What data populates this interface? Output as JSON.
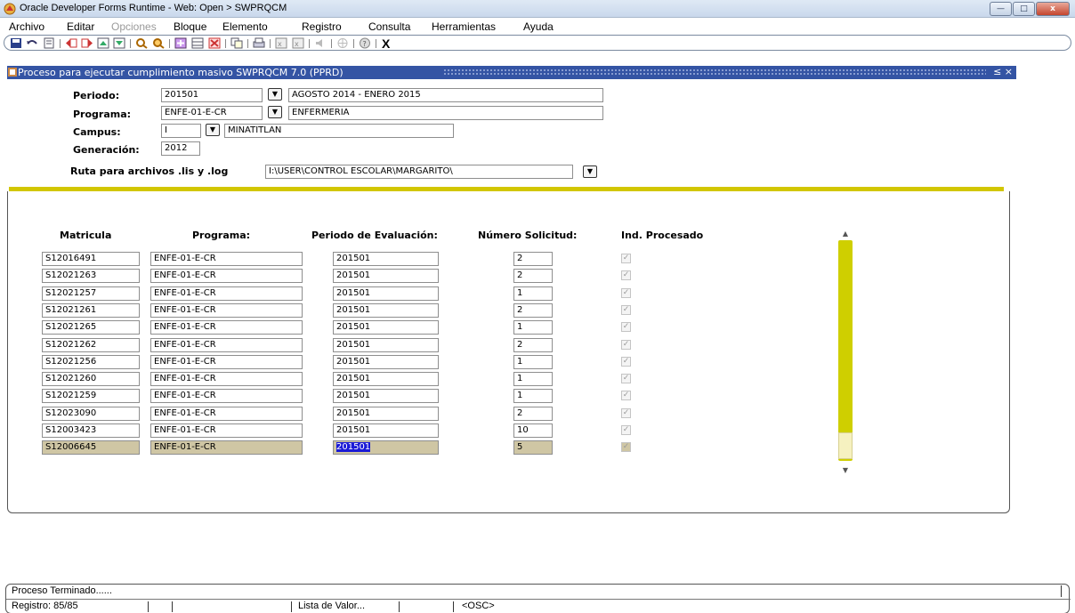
{
  "window": {
    "title": "Oracle Developer Forms Runtime - Web:  Open > SWPRQCM",
    "min_label": "—",
    "max_label": "□",
    "close_label": "x"
  },
  "menu": {
    "items": [
      {
        "label": "Archivo",
        "disabled": false
      },
      {
        "label": "Editar",
        "disabled": false
      },
      {
        "label": "Opciones",
        "disabled": true
      },
      {
        "label": "Bloque",
        "disabled": false
      },
      {
        "label": "Elemento",
        "disabled": false
      },
      {
        "label": "Registro",
        "disabled": false
      },
      {
        "label": "Consulta",
        "disabled": false
      },
      {
        "label": "Herramientas",
        "disabled": false
      },
      {
        "label": "Ayuda",
        "disabled": false
      }
    ]
  },
  "toolbar": {
    "exit_label": "X"
  },
  "form": {
    "title": "Proceso para ejecutar cumplimiento masivo  SWPRQCM  7.0  (PPRD)",
    "title_controls": "≤ ×",
    "periodo": {
      "label": "Periodo:",
      "value": "201501",
      "desc": "AGOSTO 2014 - ENERO 2015"
    },
    "programa": {
      "label": "Programa:",
      "value": "ENFE-01-E-CR",
      "desc": "ENFERMERIA"
    },
    "campus": {
      "label": "Campus:",
      "value": "I",
      "desc": "MINATITLAN"
    },
    "generacion": {
      "label": "Generación:",
      "value": "2012"
    },
    "ruta": {
      "label": "Ruta para archivos .lis y .log",
      "value": "I:\\USER\\CONTROL ESCOLAR\\MARGARITO\\"
    }
  },
  "grid": {
    "headers": {
      "matricula": "Matricula",
      "programa": "Programa:",
      "periodo": "Periodo de Evaluación:",
      "numero": "Número Solicitud:",
      "procesado": "Ind. Procesado"
    },
    "rows": [
      {
        "matricula": "S12016491",
        "programa": "ENFE-01-E-CR",
        "periodo": "201501",
        "numero": "2",
        "procesado": true
      },
      {
        "matricula": "S12021263",
        "programa": "ENFE-01-E-CR",
        "periodo": "201501",
        "numero": "2",
        "procesado": true
      },
      {
        "matricula": "S12021257",
        "programa": "ENFE-01-E-CR",
        "periodo": "201501",
        "numero": "1",
        "procesado": true
      },
      {
        "matricula": "S12021261",
        "programa": "ENFE-01-E-CR",
        "periodo": "201501",
        "numero": "2",
        "procesado": true
      },
      {
        "matricula": "S12021265",
        "programa": "ENFE-01-E-CR",
        "periodo": "201501",
        "numero": "1",
        "procesado": true
      },
      {
        "matricula": "S12021262",
        "programa": "ENFE-01-E-CR",
        "periodo": "201501",
        "numero": "2",
        "procesado": true
      },
      {
        "matricula": "S12021256",
        "programa": "ENFE-01-E-CR",
        "periodo": "201501",
        "numero": "1",
        "procesado": true
      },
      {
        "matricula": "S12021260",
        "programa": "ENFE-01-E-CR",
        "periodo": "201501",
        "numero": "1",
        "procesado": true
      },
      {
        "matricula": "S12021259",
        "programa": "ENFE-01-E-CR",
        "periodo": "201501",
        "numero": "1",
        "procesado": true
      },
      {
        "matricula": "S12023090",
        "programa": "ENFE-01-E-CR",
        "periodo": "201501",
        "numero": "2",
        "procesado": true
      },
      {
        "matricula": "S12003423",
        "programa": "ENFE-01-E-CR",
        "periodo": "201501",
        "numero": "10",
        "procesado": true
      },
      {
        "matricula": "S12006645",
        "programa": "ENFE-01-E-CR",
        "periodo": "201501",
        "numero": "5",
        "procesado": true,
        "current": true
      }
    ]
  },
  "status": {
    "message": "Proceso Terminado......",
    "registro": "Registro: 85/85",
    "lov": "Lista de Valor...",
    "osc": "<OSC>"
  },
  "colors": {
    "title_blue": "#3454a4",
    "separator_yellow": "#d2c600",
    "current_row": "#cfc6a4",
    "selection": "#1a1ad6"
  }
}
